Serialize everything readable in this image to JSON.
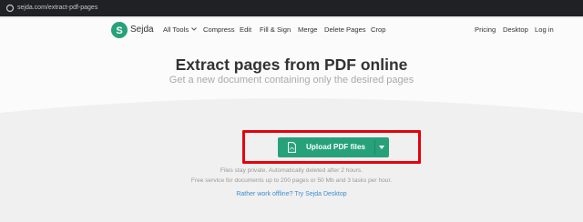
{
  "browser": {
    "url": "sejda.com/extract-pdf-pages"
  },
  "brand": {
    "logo_letter": "S",
    "name": "Sejda",
    "color": "#27a17a"
  },
  "nav": {
    "all_tools": "All Tools",
    "compress": "Compress",
    "edit": "Edit",
    "fill_sign": "Fill & Sign",
    "merge": "Merge",
    "delete_pages": "Delete Pages",
    "crop": "Crop",
    "pricing": "Pricing",
    "desktop": "Desktop",
    "login": "Log in"
  },
  "hero": {
    "title": "Extract pages from PDF online",
    "subtitle": "Get a new document containing only the desired pages"
  },
  "upload": {
    "label": "Upload PDF files",
    "button_color": "#27a17a",
    "highlight_color": "#e8000b"
  },
  "notes": {
    "line1": "Files stay private. Automatically deleted after 2 hours.",
    "line2": "Free service for documents up to 200 pages or 50 Mb and 3 tasks per hour.",
    "offline_link": "Rather work offline? Try Sejda Desktop"
  }
}
